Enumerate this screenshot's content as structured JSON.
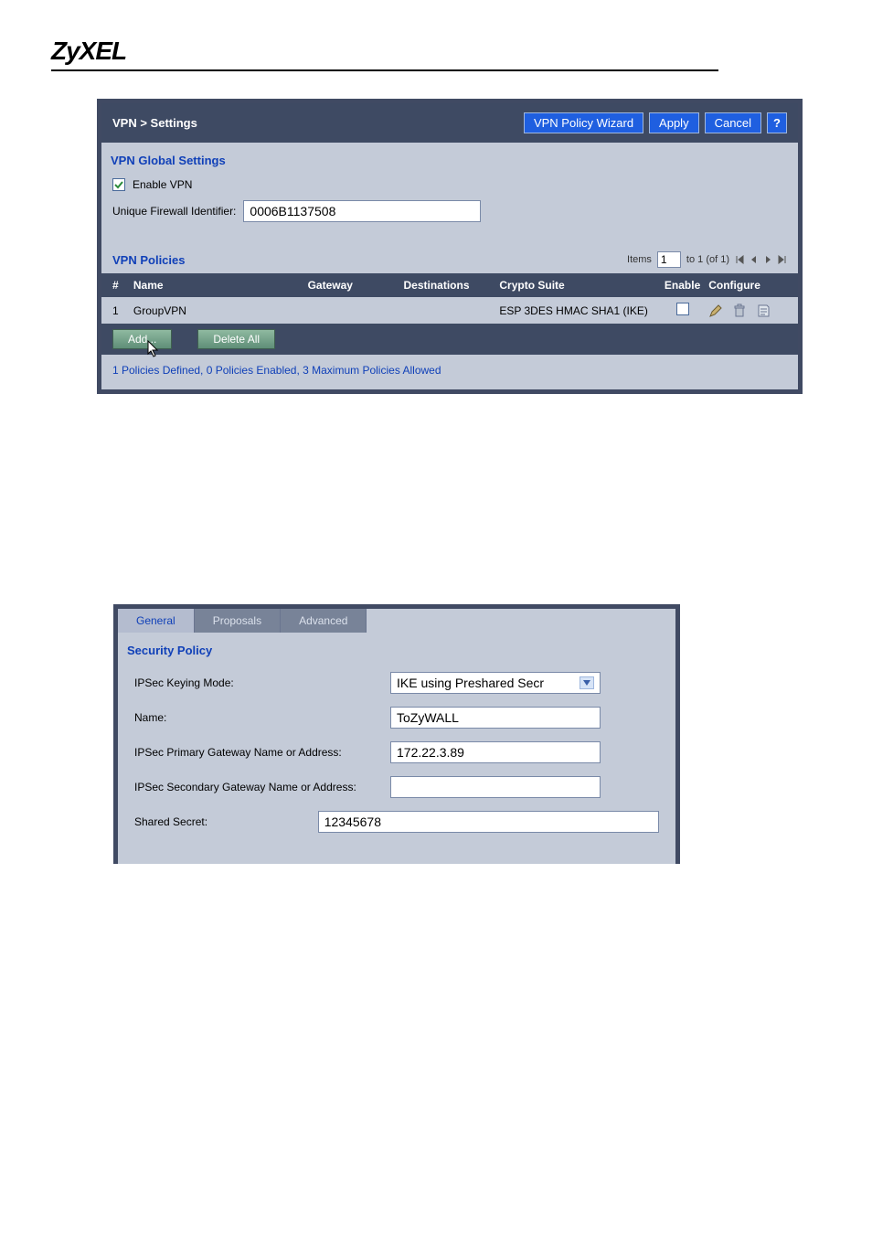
{
  "brand": "ZyXEL",
  "panel1": {
    "breadcrumb": "VPN > Settings",
    "btn_wizard": "VPN Policy Wizard",
    "btn_apply": "Apply",
    "btn_cancel": "Cancel",
    "btn_help": "?",
    "global_title": "VPN Global Settings",
    "enable_vpn_label": "Enable VPN",
    "enable_vpn_checked": true,
    "ufi_label": "Unique Firewall Identifier:",
    "ufi_value": "0006B1137508",
    "policies_title": "VPN Policies",
    "pager": {
      "items_label": "Items",
      "page_value": "1",
      "range_text": "to 1 (of 1)"
    },
    "columns": {
      "num": "#",
      "name": "Name",
      "gateway": "Gateway",
      "destinations": "Destinations",
      "crypto": "Crypto Suite",
      "enable": "Enable",
      "configure": "Configure"
    },
    "rows": [
      {
        "num": "1",
        "name": "GroupVPN",
        "gateway": "",
        "destinations": "",
        "crypto": "ESP 3DES HMAC SHA1 (IKE)",
        "enabled": false
      }
    ],
    "btn_add": "Add...",
    "btn_delete_all": "Delete All",
    "footer": "1 Policies Defined, 0 Policies Enabled, 3 Maximum Policies Allowed"
  },
  "panel2": {
    "tabs": {
      "general": "General",
      "proposals": "Proposals",
      "advanced": "Advanced"
    },
    "section_title": "Security Policy",
    "keying_mode_label": "IPSec Keying Mode:",
    "keying_mode_value": "IKE using Preshared Secr",
    "name_label": "Name:",
    "name_value": "ToZyWALL",
    "primary_gw_label": "IPSec Primary Gateway Name or Address:",
    "primary_gw_value": "172.22.3.89",
    "secondary_gw_label": "IPSec Secondary Gateway Name or Address:",
    "secondary_gw_value": "",
    "shared_secret_label": "Shared Secret:",
    "shared_secret_value": "12345678"
  }
}
